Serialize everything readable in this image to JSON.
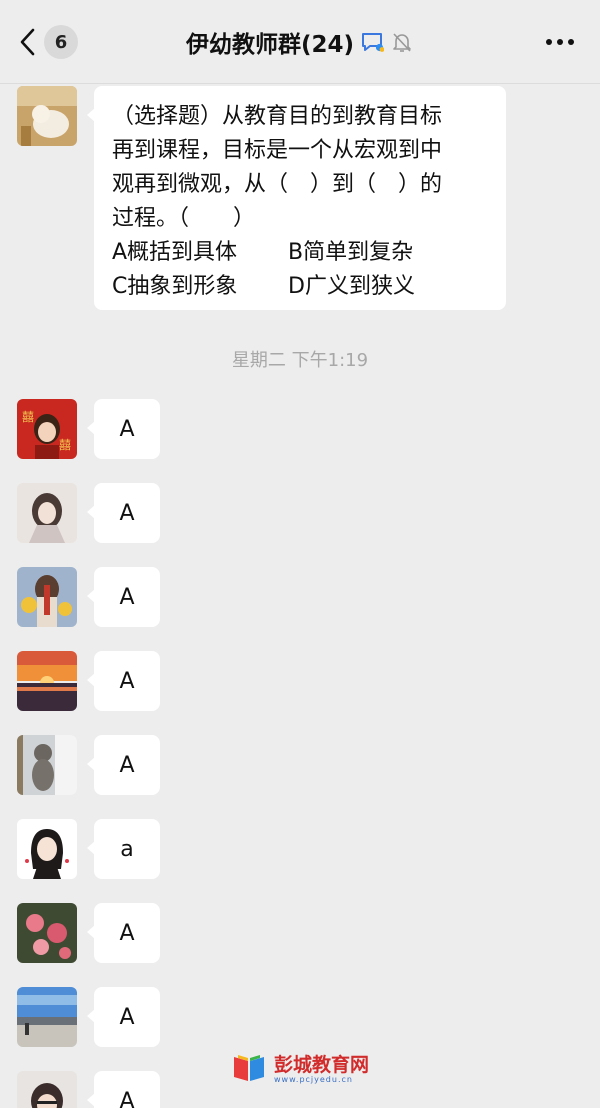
{
  "header": {
    "unread_count": "6",
    "title": "伊幼教师群(24)"
  },
  "question": {
    "lines": [
      "（选择题）从教育目的到教育目标",
      "再到课程，目标是一个从宏观到中",
      "观再到微观，从（　）到（　）的",
      "过程。（　　）"
    ],
    "options": [
      [
        "A概括到具体",
        "B简单到复杂"
      ],
      [
        "C抽象到形象",
        "D广义到狭义"
      ]
    ]
  },
  "timestamp": "星期二 下午1:19",
  "replies": [
    "A",
    "A",
    "A",
    "A",
    "A",
    "a",
    "A",
    "A",
    "A"
  ],
  "watermark": {
    "title": "彭城教育网",
    "url": "www.pcjyedu.cn"
  },
  "colors": {
    "background": "#ededed",
    "bubble": "#ffffff",
    "accent_blue": "#3a78e0"
  }
}
